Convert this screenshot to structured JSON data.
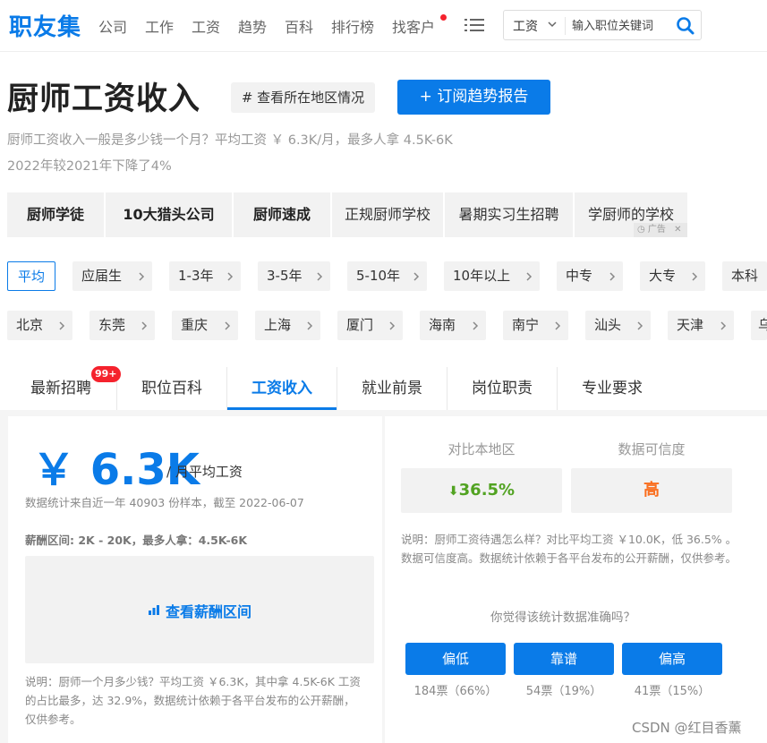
{
  "nav": {
    "logo": "职友集",
    "items": [
      "公司",
      "工作",
      "工资",
      "趋势",
      "百科",
      "排行榜",
      "找客户"
    ],
    "search": {
      "select_value": "工资",
      "placeholder": "输入职位关键词"
    }
  },
  "header": {
    "title": "厨师工资收入",
    "region_button": "# 查看所在地区情况",
    "subscribe_button": "+ 订阅趋势报告",
    "desc_line1": "厨师工资收入一般是多少钱一个月？平均工资 ￥ 6.3K/月，最多人拿 4.5K-6K",
    "desc_line2": "2022年较2021年下降了4%"
  },
  "keywords": [
    "厨师学徒",
    "10大猎头公司",
    "厨师速成",
    "正规厨师学校",
    "暑期实习生招聘",
    "学厨师的学校"
  ],
  "ad_label": "广告",
  "experience_filters": [
    "平均",
    "应届生",
    "1-3年",
    "3-5年",
    "5-10年",
    "10年以上",
    "中专",
    "大专",
    "本科"
  ],
  "city_filters": [
    "北京",
    "东莞",
    "重庆",
    "上海",
    "厦门",
    "海南",
    "南宁",
    "汕头",
    "天津",
    "乌"
  ],
  "tabs": [
    "最新招聘",
    "职位百科",
    "工资收入",
    "就业前景",
    "岗位职责",
    "专业要求"
  ],
  "tab_badge": "99+",
  "salary": {
    "value": "￥ 6.3K",
    "unit": "/ 月平均工资",
    "note": "数据统计来自近一年 40903 份样本，截至 2022-06-07",
    "range_label": "薪酬区间: 2K - 20K，最多人拿：4.5K-6K",
    "range_button": "查看薪酬区间",
    "explain": "说明：厨师一个月多少钱？平均工资 ￥6.3K，其中拿 4.5K-6K 工资的占比最多，达 32.9%，数据统计依赖于各平台发布的公开薪酬，仅供参考。"
  },
  "compare": {
    "local_label": "对比本地区",
    "local_value": "36.5%",
    "credibility_label": "数据可信度",
    "credibility_value": "高",
    "explain": "说明：厨师工资待遇怎么样？对比平均工资 ￥10.0K，低 36.5% 。数据可信度高。数据统计依赖于各平台发布的公开薪酬，仅供参考。",
    "question": "你觉得该统计数据准确吗？",
    "votes": [
      {
        "label": "偏低",
        "count": "184票（66%）"
      },
      {
        "label": "靠谱",
        "count": "54票（19%）"
      },
      {
        "label": "偏高",
        "count": "41票（15%）"
      }
    ]
  },
  "watermark": "CSDN @红目香薰",
  "colors": {
    "brand": "#0a7be8",
    "down": "#52a322",
    "high": "#fa6e1e",
    "alert": "#f5222d"
  }
}
